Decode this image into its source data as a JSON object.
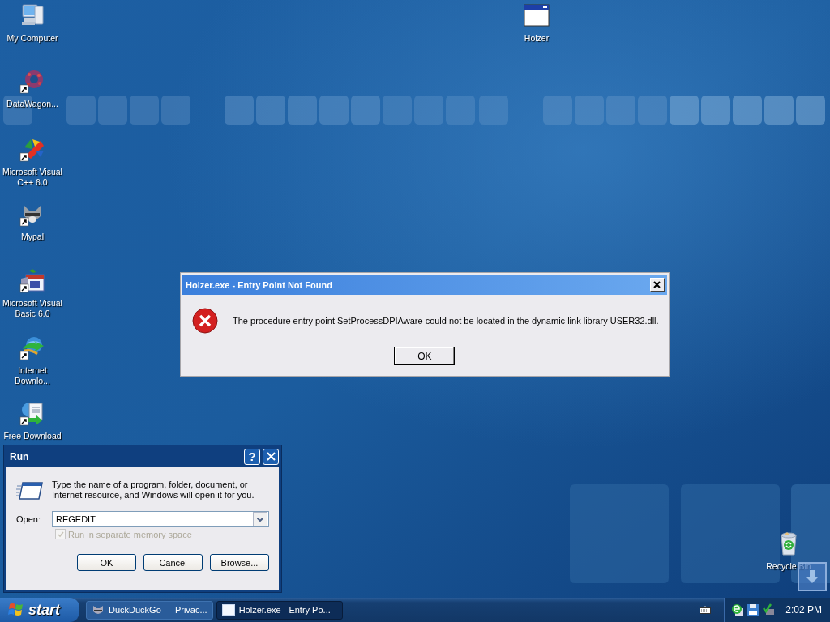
{
  "desktop_icons": [
    {
      "label": "My Computer",
      "shortcut": false
    },
    {
      "label": "DataWagon...",
      "shortcut": true
    },
    {
      "label": "Microsoft Visual C++ 6.0",
      "shortcut": true
    },
    {
      "label": "Mypal",
      "shortcut": true
    },
    {
      "label": "Microsoft Visual Basic 6.0",
      "shortcut": true
    },
    {
      "label": "Internet Downlo...",
      "shortcut": true
    },
    {
      "label": "Free Download",
      "shortcut": true
    },
    {
      "label": "Holzer",
      "shortcut": false
    },
    {
      "label": "Recycle Bin",
      "shortcut": false
    }
  ],
  "error_dialog": {
    "title": "Holzer.exe - Entry Point Not Found",
    "message": "The procedure entry point SetProcessDPIAware could not be located in the dynamic link library USER32.dll.",
    "buttons": [
      "OK"
    ]
  },
  "run_dialog": {
    "title": "Run",
    "help_button": "?",
    "description": "Type the name of a program, folder, document, or Internet resource, and Windows will open it for you.",
    "open_label": "Open:",
    "open_value": "REGEDIT",
    "checkbox": {
      "label": "Run in separate memory space",
      "checked": true,
      "disabled": true
    },
    "buttons": [
      "OK",
      "Cancel",
      "Browse..."
    ]
  },
  "taskbar": {
    "start_label": "start",
    "tasks": [
      {
        "label": "DuckDuckGo — Privac...",
        "selected": false
      },
      {
        "label": "Holzer.exe - Entry Po...",
        "selected": true
      }
    ],
    "clock": "2:02 PM"
  }
}
